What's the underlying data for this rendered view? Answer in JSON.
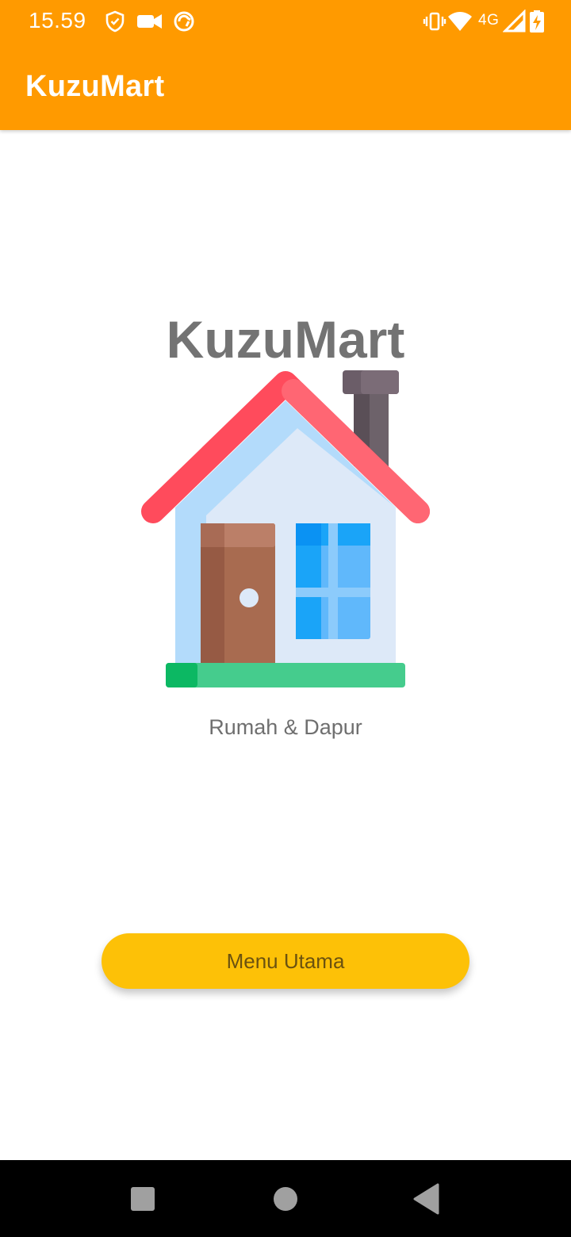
{
  "status_bar": {
    "time": "15.59",
    "network": "4G",
    "icons": [
      "shield-check-icon",
      "video-camera-icon",
      "sync-icon",
      "vibrate-icon",
      "wifi-icon",
      "signal-icon",
      "battery-charging-icon"
    ]
  },
  "app_bar": {
    "title": "KuzuMart",
    "background": "#ff9a00"
  },
  "splash": {
    "title": "KuzuMart",
    "subtitle": "Rumah & Dapur",
    "illustration": "house-icon"
  },
  "actions": {
    "menu_button_label": "Menu Utama",
    "menu_button_color": "#fdc107"
  },
  "navigation": {
    "buttons": [
      "recents-icon",
      "home-icon",
      "back-icon"
    ]
  }
}
